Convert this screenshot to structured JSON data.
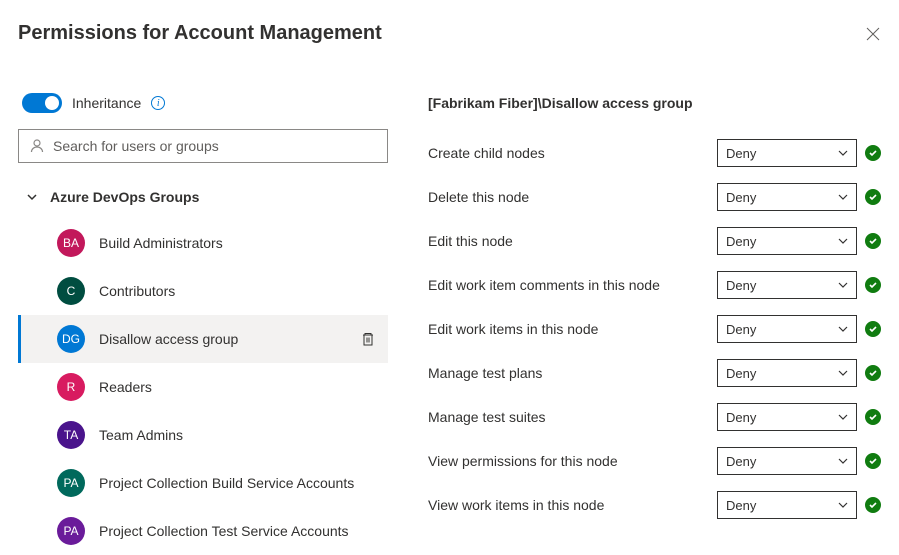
{
  "title": "Permissions for Account Management",
  "inheritance_label": "Inheritance",
  "search_placeholder": "Search for users or groups",
  "section_header": "Azure DevOps Groups",
  "groups": [
    {
      "initials": "BA",
      "name": "Build Administrators",
      "color": "#c2185b",
      "selected": false
    },
    {
      "initials": "C",
      "name": "Contributors",
      "color": "#004d40",
      "selected": false
    },
    {
      "initials": "DG",
      "name": "Disallow access group",
      "color": "#0078d4",
      "selected": true
    },
    {
      "initials": "R",
      "name": "Readers",
      "color": "#d81b60",
      "selected": false
    },
    {
      "initials": "TA",
      "name": "Team Admins",
      "color": "#4a148c",
      "selected": false
    },
    {
      "initials": "PA",
      "name": "Project Collection Build Service Accounts",
      "color": "#00695c",
      "selected": false
    },
    {
      "initials": "PA",
      "name": "Project Collection Test Service Accounts",
      "color": "#6a1b9a",
      "selected": false
    }
  ],
  "detail_title": "[Fabrikam Fiber]\\Disallow access group",
  "permissions": [
    {
      "label": "Create child nodes",
      "value": "Deny"
    },
    {
      "label": "Delete this node",
      "value": "Deny"
    },
    {
      "label": "Edit this node",
      "value": "Deny"
    },
    {
      "label": "Edit work item comments in this node",
      "value": "Deny"
    },
    {
      "label": "Edit work items in this node",
      "value": "Deny"
    },
    {
      "label": "Manage test plans",
      "value": "Deny"
    },
    {
      "label": "Manage test suites",
      "value": "Deny"
    },
    {
      "label": "View permissions for this node",
      "value": "Deny"
    },
    {
      "label": "View work items in this node",
      "value": "Deny"
    }
  ]
}
